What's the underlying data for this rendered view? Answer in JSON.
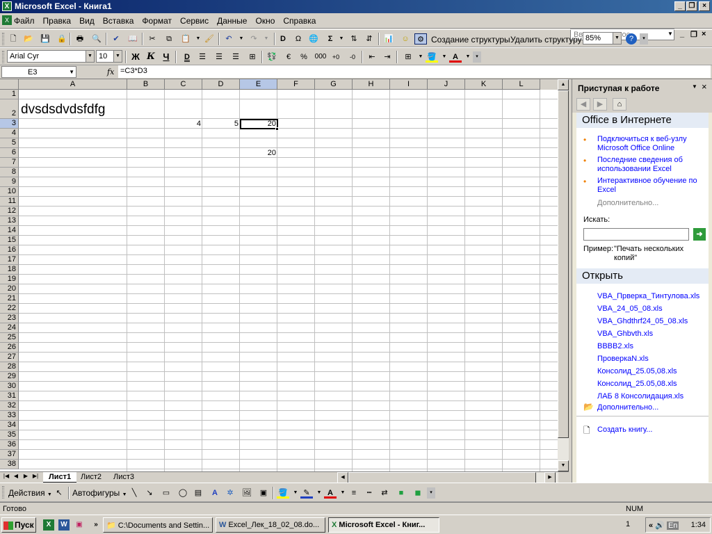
{
  "window": {
    "title": "Microsoft Excel - Книга1",
    "app_icon": "excel-icon"
  },
  "menu": {
    "items": [
      "Файл",
      "Правка",
      "Вид",
      "Вставка",
      "Формат",
      "Сервис",
      "Данные",
      "Окно",
      "Справка"
    ],
    "ask_placeholder": "Введите вопрос"
  },
  "standard_toolbar": {
    "create_structure": "Создание структуры",
    "delete_structure": "Удалить структуру",
    "zoom": "85%"
  },
  "format_toolbar": {
    "font": "Arial Cyr",
    "size": "10",
    "bold": "Ж",
    "italic": "К",
    "underline": "Ч",
    "percent": "%",
    "thousands": "000"
  },
  "formula_bar": {
    "name_box": "E3",
    "fx": "fx",
    "formula": "=C3*D3"
  },
  "sheet": {
    "columns": [
      "A",
      "B",
      "C",
      "D",
      "E",
      "F",
      "G",
      "H",
      "I",
      "J",
      "K",
      "L"
    ],
    "selected_column": "E",
    "rows": [
      "1",
      "2",
      "3",
      "4",
      "5",
      "6",
      "7",
      "8",
      "9",
      "10",
      "11",
      "12",
      "13",
      "14",
      "15",
      "16",
      "17",
      "18",
      "19",
      "20",
      "21",
      "22",
      "23",
      "24",
      "25",
      "26",
      "27",
      "28",
      "29",
      "30",
      "31",
      "32",
      "33",
      "34",
      "35",
      "36",
      "37",
      "38"
    ],
    "selected_row": "3",
    "cells": {
      "A2": "dvsdsdvdsfdfg",
      "C3": "4",
      "D3": "5",
      "E3": "20",
      "E6": "20"
    },
    "tabs": [
      "Лист1",
      "Лист2",
      "Лист3"
    ],
    "active_tab": "Лист1"
  },
  "task_pane": {
    "title": "Приступая к работе",
    "office_section": "Office в Интернете",
    "office_links": [
      "Подключиться к веб-узлу Microsoft Office Online",
      "Последние сведения об использовании Excel",
      "Интерактивное обучение по Excel"
    ],
    "more": "Дополнительно...",
    "search_label": "Искать:",
    "example_label": "Пример:",
    "example_text": "\"Печать нескольких копий\"",
    "open_section": "Открыть",
    "files": [
      "VBA_Прверка_Тинтулова.xls",
      "VBA_24_05_08.xls",
      "VBA_Ghdthrf24_05_08.xls",
      "VBA_Ghbvth.xls",
      "BBBB2.xls",
      "ПроверкаN.xls",
      "Консолид_25.05,08.xls",
      "Консолид_25.05,08.xls",
      "ЛАБ 8 Консолидация.xls"
    ],
    "open_more": "Дополнительно...",
    "create": "Создать книгу..."
  },
  "drawing_toolbar": {
    "actions": "Действия",
    "autoshapes": "Автофигуры"
  },
  "status": {
    "text": "Готово",
    "num": "NUM"
  },
  "taskbar": {
    "start": "Пуск",
    "tasks": [
      "C:\\Documents and Settin...",
      "Excel_Лек_18_02_08.do...",
      "Microsoft Excel - Книг..."
    ],
    "active_task": 2,
    "page_indicator": "1",
    "lang": "En",
    "clock": "1:34"
  }
}
